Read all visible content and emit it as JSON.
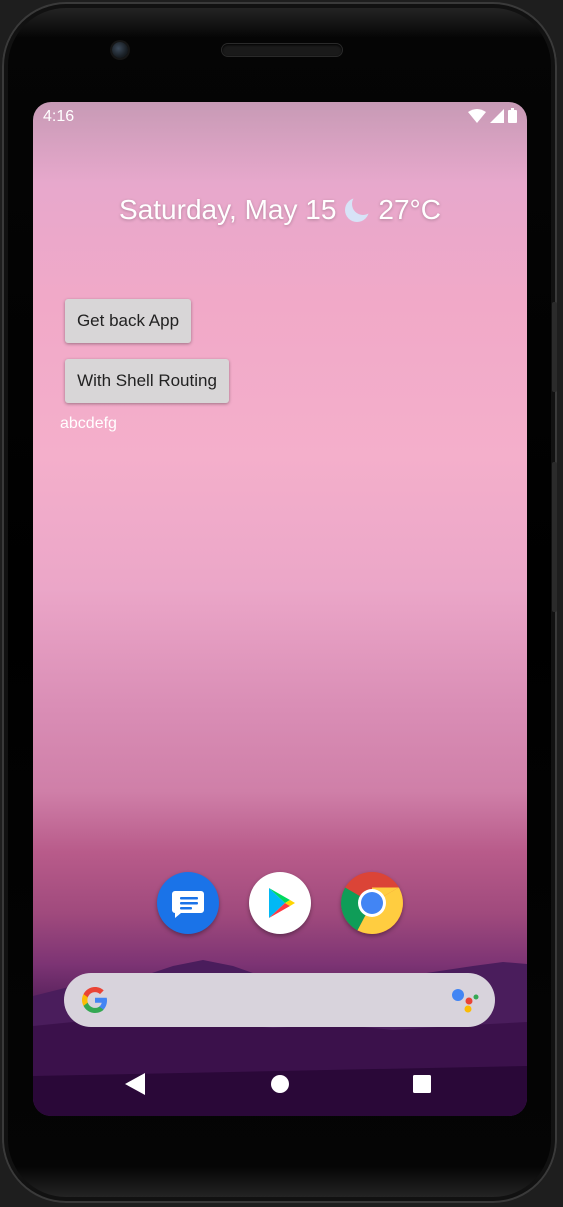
{
  "status_bar": {
    "time": "4:16"
  },
  "date_widget": {
    "date_text": "Saturday, May 15",
    "temperature": "27°C",
    "weather_icon": "moon-icon"
  },
  "app_ui": {
    "get_back_button": "Get back App",
    "shell_routing_button": "With Shell Routing",
    "label": "abcdefg"
  },
  "dock": {
    "apps": [
      {
        "name": "Messages",
        "icon": "messages-icon",
        "color": "#1a73e8"
      },
      {
        "name": "Play Store",
        "icon": "play-store-icon",
        "color": "#ffffff"
      },
      {
        "name": "Chrome",
        "icon": "chrome-icon",
        "color": "#ffffff"
      }
    ]
  },
  "search_bar": {
    "left_icon": "google-g-icon",
    "right_icon": "assistant-icon"
  },
  "nav_bar": {
    "back_icon": "back-icon",
    "home_icon": "home-icon",
    "recents_icon": "recents-icon"
  },
  "colors": {
    "button_bg": "#d8d6d7",
    "search_bg": "#d8d3dc"
  }
}
